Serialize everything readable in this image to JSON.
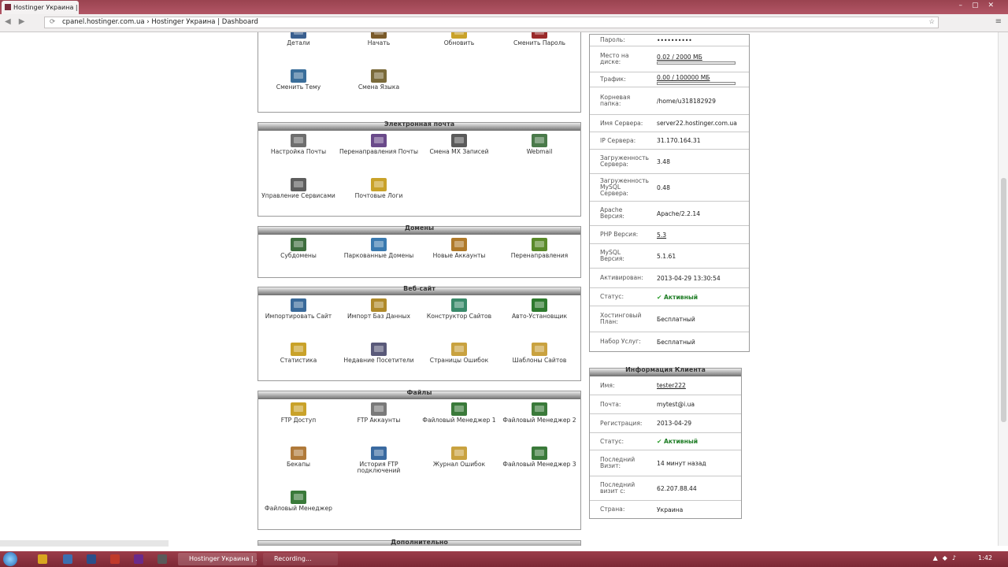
{
  "browser": {
    "tab_title": "Hostinger Украина | D...",
    "url": "cpanel.hostinger.com.ua",
    "breadcrumb_sep": "›",
    "page_title": "Hostinger Украина | Dashboard"
  },
  "panels": [
    {
      "title": "",
      "items": [
        {
          "label": "Детали",
          "color": "#3a5f8f"
        },
        {
          "label": "Начать",
          "color": "#7a5a2a"
        },
        {
          "label": "Обновить",
          "color": "#c9a22a"
        },
        {
          "label": "Сменить Пароль",
          "color": "#9a2a2a"
        },
        {
          "label": "Сменить Тему",
          "color": "#3a6e9a"
        },
        {
          "label": "Смена Языка",
          "color": "#7a6a3a"
        }
      ]
    },
    {
      "title": "Электронная почта",
      "items": [
        {
          "label": "Настройка Почты",
          "color": "#6e6e6e"
        },
        {
          "label": "Перенаправления Почты",
          "color": "#6a4a8a"
        },
        {
          "label": "Смена MX Записей",
          "color": "#5a5a5a"
        },
        {
          "label": "Webmail",
          "color": "#4a7a4a"
        },
        {
          "label": "Управление Сервисами",
          "color": "#5e5e5e"
        },
        {
          "label": "Почтовые Логи",
          "color": "#c9a22a"
        }
      ]
    },
    {
      "title": "Домены",
      "items": [
        {
          "label": "Субдомены",
          "color": "#3e6e3e"
        },
        {
          "label": "Паркованные Домены",
          "color": "#3a7ab0"
        },
        {
          "label": "Новые Аккаунты",
          "color": "#b07a2a"
        },
        {
          "label": "Перенаправления",
          "color": "#5a8a2a"
        }
      ]
    },
    {
      "title": "Веб-сайт",
      "items": [
        {
          "label": "Импортировать Сайт",
          "color": "#3a6a9a"
        },
        {
          "label": "Импорт Баз Данных",
          "color": "#b08a2a"
        },
        {
          "label": "Конструктор Сайтов",
          "color": "#3a8a6a"
        },
        {
          "label": "Авто-Установщик",
          "color": "#2e7a2e"
        },
        {
          "label": "Статистика",
          "color": "#c9a22a"
        },
        {
          "label": "Недавние Посетители",
          "color": "#5a5a7a"
        },
        {
          "label": "Страницы Ошибок",
          "color": "#c9a240"
        },
        {
          "label": "Шаблоны Сайтов",
          "color": "#c9a240"
        }
      ]
    },
    {
      "title": "Файлы",
      "items": [
        {
          "label": "FTP Доступ",
          "color": "#c9a22a"
        },
        {
          "label": "FTP Аккаунты",
          "color": "#7a7a7a"
        },
        {
          "label": "Файловый Менеджер 1",
          "color": "#3a7a3a"
        },
        {
          "label": "Файловый Менеджер 2",
          "color": "#3a7a3a"
        },
        {
          "label": "Бекапы",
          "color": "#b07a3a"
        },
        {
          "label": "История FTP подключений",
          "color": "#3a6aa0"
        },
        {
          "label": "Журнал Ошибок",
          "color": "#c9a240"
        },
        {
          "label": "Файловый Менеджер 3",
          "color": "#3a7a3a"
        },
        {
          "label": "Файловый Менеджер",
          "color": "#3a7a3a"
        }
      ]
    },
    {
      "title": "Дополнительно",
      "items": []
    }
  ],
  "account_info": {
    "rows": [
      {
        "key": "Пароль:",
        "value": "••••••••••"
      },
      {
        "key": "Место на диске:",
        "value": "0.02 / 2000 МБ",
        "bar": 1e-05
      },
      {
        "key": "Трафик:",
        "value": "0.00 / 100000 МБ",
        "bar": 0
      },
      {
        "key": "Корневая папка:",
        "value": "/home/u318182929"
      },
      {
        "key": "Имя Сервера:",
        "value": "server22.hostinger.com.ua"
      },
      {
        "key": "IP Сервера:",
        "value": "31.170.164.31"
      },
      {
        "key": "Загруженность Сервера:",
        "value": "3.48"
      },
      {
        "key": "Загруженность MySQL Сервера:",
        "value": "0.48"
      },
      {
        "key": "Apache Версия:",
        "value": "Apache/2.2.14"
      },
      {
        "key": "PHP Версия:",
        "value": "5.3"
      },
      {
        "key": "MySQL Версия:",
        "value": "5.1.61"
      },
      {
        "key": "Активирован:",
        "value": "2013-04-29 13:30:54"
      },
      {
        "key": "Статус:",
        "value": "Активный",
        "status": true
      },
      {
        "key": "Хостинговый План:",
        "value": "Бесплатный"
      },
      {
        "key": "Набор Услуг:",
        "value": "Бесплатный"
      }
    ]
  },
  "client_info": {
    "title": "Информация Клиента",
    "rows": [
      {
        "key": "Имя:",
        "value": "tester222"
      },
      {
        "key": "Почта:",
        "value": "mytest@i.ua"
      },
      {
        "key": "Регистрация:",
        "value": "2013-04-29"
      },
      {
        "key": "Статус:",
        "value": "Активный",
        "status": true
      },
      {
        "key": "Последний Визит:",
        "value": "14 минут назад"
      },
      {
        "key": "Последний визит с:",
        "value": "62.207.88.44"
      },
      {
        "key": "Страна:",
        "value": "Украина"
      }
    ]
  },
  "taskbar": {
    "task1": "Hostinger Украина | ...",
    "task2": "Recording...",
    "clock": "1:42"
  }
}
